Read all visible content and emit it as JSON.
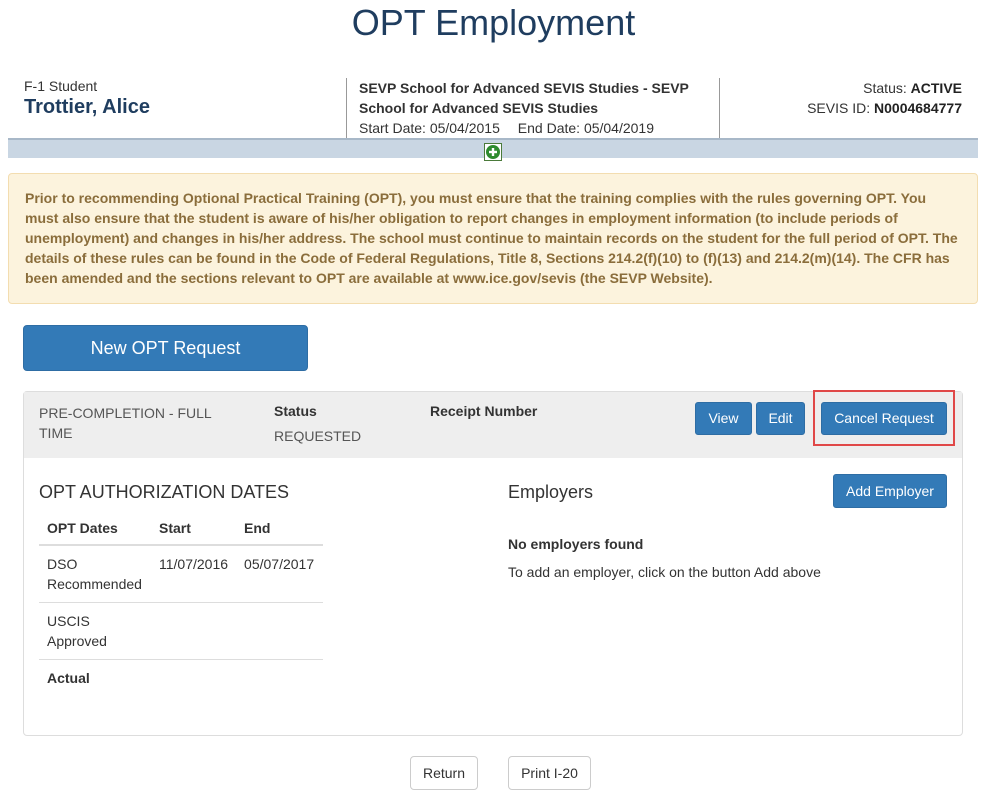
{
  "page": {
    "title": "OPT Employment"
  },
  "student": {
    "type_label": "F-1 Student",
    "name": "Trottier, Alice",
    "school_name": "SEVP School for Advanced SEVIS Studies - SEVP School for Advanced SEVIS Studies",
    "start_date_label": "Start Date:",
    "start_date": "05/04/2015",
    "end_date_label": "End Date:",
    "end_date": "05/04/2019",
    "status_label": "Status:",
    "status": "ACTIVE",
    "sevis_id_label": "SEVIS ID:",
    "sevis_id": "N0004684777"
  },
  "alert": {
    "text": "Prior to recommending Optional Practical Training (OPT), you must ensure that the training complies with the rules governing OPT. You must also ensure that the student is aware of his/her obligation to report changes in employment information (to include periods of unemployment) and changes in his/her address. The school must continue to maintain records on the student for the full period of OPT. The details of these rules can be found in the Code of Federal Regulations, Title 8, Sections 214.2(f)(10) to (f)(13) and 214.2(m)(14). The CFR has been amended and the sections relevant to OPT are available at www.ice.gov/sevis (the SEVP Website)."
  },
  "actions": {
    "new_request_label": "New OPT Request"
  },
  "request": {
    "type": "PRE-COMPLETION - FULL TIME",
    "status_label": "Status",
    "status": "REQUESTED",
    "receipt_label": "Receipt Number",
    "view_label": "View",
    "edit_label": "Edit",
    "cancel_label": "Cancel Request"
  },
  "authorization": {
    "title": "OPT AUTHORIZATION DATES",
    "headers": [
      "OPT Dates",
      "Start",
      "End"
    ],
    "rows": [
      {
        "label": "DSO Recommended",
        "start": "11/07/2016",
        "end": "05/07/2017"
      },
      {
        "label": "USCIS Approved",
        "start": "",
        "end": ""
      },
      {
        "label": "Actual",
        "start": "",
        "end": ""
      }
    ]
  },
  "employers": {
    "title": "Employers",
    "add_label": "Add Employer",
    "empty_title": "No employers found",
    "empty_help": "To add an employer, click on the button Add above"
  },
  "footer": {
    "return_label": "Return",
    "print_label": "Print I-20"
  },
  "colors": {
    "title_blue": "#1f3d5f",
    "primary_button": "#337ab7",
    "alert_background": "#fcf3dd",
    "alert_text": "#8a6d3b",
    "highlight_border": "#e04848"
  },
  "icons": {
    "expand": "plus-circle-icon"
  }
}
